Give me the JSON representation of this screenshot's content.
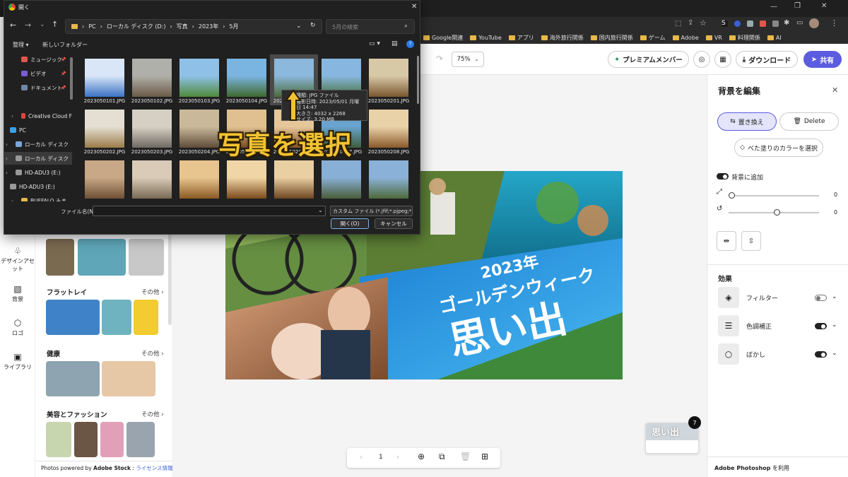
{
  "dialog": {
    "title": "開く",
    "breadcrumb": [
      "PC",
      "ローカル ディスク (D:)",
      "写真",
      "2023年",
      "5月"
    ],
    "search_placeholder": "5月の検索",
    "organize": "整理",
    "new_folder": "新しいフォルダー",
    "tree": [
      {
        "label": "ミュージック",
        "icon": "music-icon",
        "color": "#e0584a"
      },
      {
        "label": "ビデオ",
        "icon": "video-icon",
        "color": "#7b5cd6"
      },
      {
        "label": "ドキュメント",
        "icon": "document-icon",
        "color": "#6e86a8"
      },
      {
        "label": "Creative Cloud F",
        "icon": "folder-icon",
        "color": "#d24b3a"
      },
      {
        "label": "PC",
        "icon": "pc-icon",
        "color": "#3aa0e8"
      },
      {
        "label": "ローカル ディスク",
        "icon": "drive-icon",
        "color": "#7aa7d8"
      },
      {
        "label": "ローカル ディスク",
        "icon": "drive-icon",
        "color": "#999999"
      },
      {
        "label": "HD-ADU3 (E:)",
        "icon": "drive-icon",
        "color": "#999999"
      },
      {
        "label": "HD-ADU3 (E:)",
        "icon": "drive-icon",
        "color": "#999999"
      },
      {
        "label": "BUFFALO みま",
        "icon": "folder-icon",
        "color": "#e8b949"
      }
    ],
    "files": [
      {
        "name": "2023050101.JPG",
        "c1": "#d9e6f7",
        "c2": "#3b72c4"
      },
      {
        "name": "2023050102.JPG",
        "c1": "#b0b0aa",
        "c2": "#6b5a46"
      },
      {
        "name": "2023050103.JPG",
        "c1": "#8fc1e8",
        "c2": "#4f8a3a"
      },
      {
        "name": "2023050104.JPG",
        "c1": "#7ab4e0",
        "c2": "#3f6a2f"
      },
      {
        "name": "2023050105.JPG",
        "c1": "#8bb8dc",
        "c2": "#4c6a3a"
      },
      {
        "name": "2023050106.JPG",
        "c1": "#87b7e0",
        "c2": "#49703a"
      },
      {
        "name": "2023050201.JPG",
        "c1": "#d8c9a6",
        "c2": "#7a5730"
      },
      {
        "name": "2023050202.JPG",
        "c1": "#e4dfd2",
        "c2": "#9c7c4a"
      },
      {
        "name": "2023050203.JPG",
        "c1": "#d6d0c4",
        "c2": "#6f6a62"
      },
      {
        "name": "2023050204.JPG",
        "c1": "#c9b99a",
        "c2": "#5f4c38"
      },
      {
        "name": "2023050205.JPG",
        "c1": "#e0c090",
        "c2": "#7a4c22"
      },
      {
        "name": "2023050206.JPG",
        "c1": "#e6c79a",
        "c2": "#8a5324"
      },
      {
        "name": "2023050207.JPG",
        "c1": "#6aa3cf",
        "c2": "#3e5f3c"
      },
      {
        "name": "2023050208.JPG",
        "c1": "#e9d2a8",
        "c2": "#8a5a2b"
      },
      {
        "name": "",
        "c1": "#c9a887",
        "c2": "#6e4f34"
      },
      {
        "name": "",
        "c1": "#d9cbb7",
        "c2": "#7a6a56"
      },
      {
        "name": "",
        "c1": "#e8c58e",
        "c2": "#8c5a25"
      },
      {
        "name": "",
        "c1": "#f0d6a6",
        "c2": "#7c4a1c"
      },
      {
        "name": "",
        "c1": "#e9cfa2",
        "c2": "#6e4620"
      },
      {
        "name": "",
        "c1": "#88b0d6",
        "c2": "#4a5d3a"
      },
      {
        "name": "",
        "c1": "#8ab2d8",
        "c2": "#4e6a3c"
      }
    ],
    "tooltip": {
      "type": "種類: JPG ファイル",
      "date": "撮影日時: 2023/05/01 月曜日 14:47",
      "dims": "大きさ: 4032 x 2268",
      "size": "サイズ: 3.20 MB"
    },
    "filename_label": "ファイル名(N):",
    "filename_value": "",
    "filetype": "カスタム ファイル (*.jfif;*.pjpeg;*.jp",
    "open_button": "開く(O)",
    "cancel_button": "キャンセル"
  },
  "overlay_text": "写真を選択",
  "bookmarks": [
    "Google関連",
    "YouTube",
    "アプリ",
    "海外旅行関係",
    "国内旅行関係",
    "ゲーム",
    "Adobe",
    "VR",
    "料理関係",
    "AI"
  ],
  "toolbar": {
    "zoom": "75%",
    "premium": "プレミアムメンバー",
    "download": "ダウンロード",
    "share": "共有"
  },
  "right_panel": {
    "title": "背景を編集",
    "replace": "置き換え",
    "delete": "Delete",
    "fill_color": "べた塗りのカラーを選択",
    "add_background": "背景に追加",
    "slider1_value": "0",
    "slider2_value": "0",
    "slider1_level": 0,
    "slider2_level": 0.5,
    "effects_title": "効果",
    "effects": [
      {
        "label": "フィルター",
        "on": false
      },
      {
        "label": "色調補正",
        "on": true
      },
      {
        "label": "ぼかし",
        "on": true
      }
    ],
    "footer_brand": "Adobe Photoshop",
    "footer_suffix": " を利用"
  },
  "left_rail": [
    {
      "label": "デザインアセット",
      "icon": "design-assets-icon",
      "glyph": "♧"
    },
    {
      "label": "背景",
      "icon": "background-icon",
      "glyph": "▧"
    },
    {
      "label": "ロゴ",
      "icon": "logo-icon",
      "glyph": "⬡"
    },
    {
      "label": "ライブラリ",
      "icon": "library-icon",
      "glyph": "▣"
    }
  ],
  "left_panel": {
    "sections": [
      {
        "title": "フラットレイ",
        "more": "その他 ›"
      },
      {
        "title": "健康",
        "more": "その他 ›"
      },
      {
        "title": "美容とファッション",
        "more": "その他 ›"
      }
    ],
    "footer_prefix": "Photos powered by ",
    "footer_brand": "Adobe Stock",
    "footer_sep": " : ",
    "footer_link": "ライセンス情報"
  },
  "design": {
    "year": "2023年",
    "subtitle": "ゴールデンウィーク",
    "title": "思い出"
  },
  "page_bar": {
    "page": "1"
  },
  "badge_count": "7",
  "page_thumb_text": "思い出"
}
